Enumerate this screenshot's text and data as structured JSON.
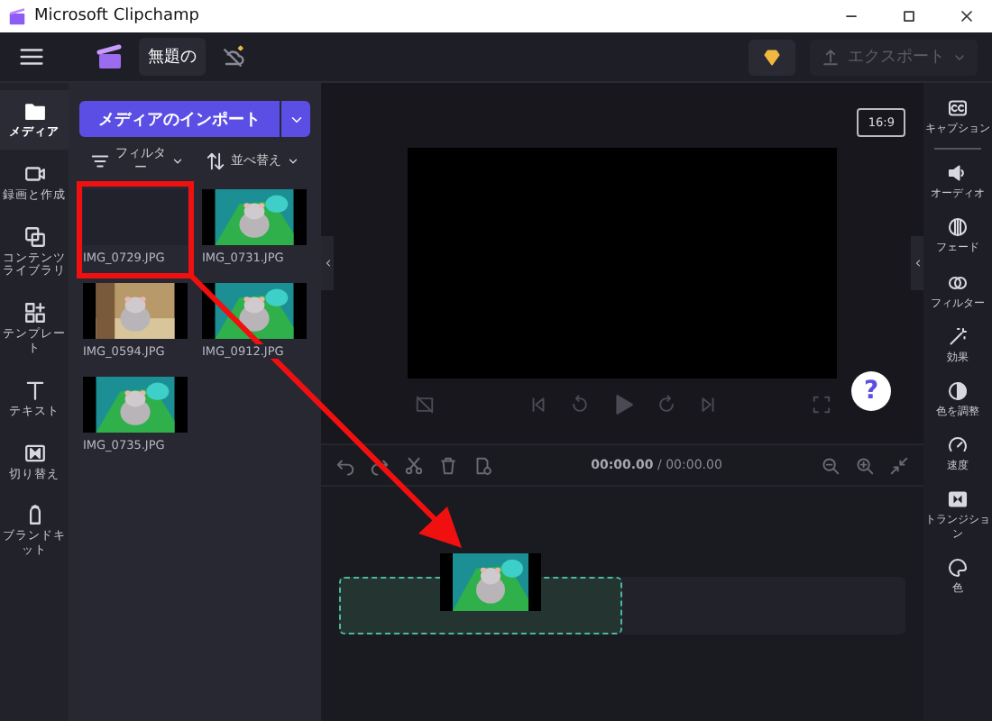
{
  "window": {
    "title": "Microsoft Clipchamp"
  },
  "header": {
    "project_name": "無題の",
    "export_button": {
      "label": "エクスポート",
      "disabled": true
    }
  },
  "nav": [
    {
      "label": "メディア",
      "selected": true
    },
    {
      "label": "録画と作成",
      "selected": false
    },
    {
      "label": "コンテンツライブラリ",
      "selected": false
    },
    {
      "label": "テンプレート",
      "selected": false
    },
    {
      "label": "テキスト",
      "selected": false
    },
    {
      "label": "切り替え",
      "selected": false
    },
    {
      "label": "ブランドキット",
      "selected": false
    }
  ],
  "media_panel": {
    "import_button": "メディアのインポート",
    "filter": "フィルター",
    "sort": "並べ替え",
    "items": [
      {
        "name": "IMG_0729.JPG",
        "kind": "blank"
      },
      {
        "name": "IMG_0731.JPG",
        "kind": "picture"
      },
      {
        "name": "IMG_0594.JPG",
        "kind": "picture"
      },
      {
        "name": "IMG_0912.JPG",
        "kind": "picture"
      },
      {
        "name": "IMG_0735.JPG",
        "kind": "picture"
      }
    ]
  },
  "preview": {
    "aspect_ratio": "16:9",
    "help": "?"
  },
  "timeline": {
    "time_current": "00:00.00",
    "time_total": "/ 00:00.00"
  },
  "tools": [
    {
      "label": "キャプション"
    },
    {
      "label": "オーディオ"
    },
    {
      "label": "フェード"
    },
    {
      "label": "フィルター"
    },
    {
      "label": "効果"
    },
    {
      "label": "色を調整"
    },
    {
      "label": "速度"
    },
    {
      "label": "トランジション"
    },
    {
      "label": "色"
    }
  ]
}
